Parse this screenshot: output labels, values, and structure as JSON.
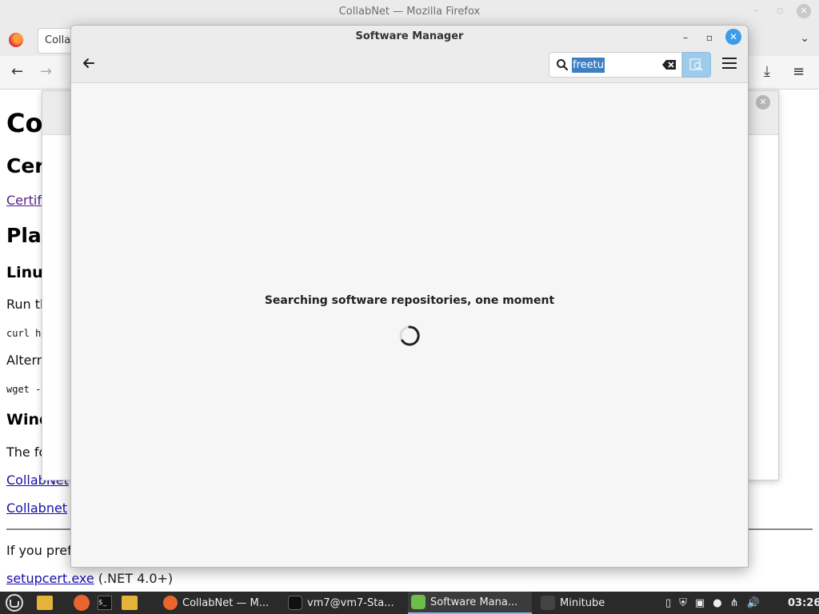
{
  "firefox": {
    "window_title": "CollabNet — Mozilla Firefox",
    "tab_label": "Collab",
    "content": {
      "h1": "Co",
      "h2_cert": "Cer",
      "link_cert": "Certif",
      "h2_plat": "Pla",
      "h3_linux": "Linu",
      "p_run": "Run th",
      "code_curl": "curl h",
      "p_alt": "Altern",
      "code_wget": "wget -",
      "h3_win": "Wind",
      "p_the": "The fo",
      "link_collab1": "CollabNet",
      "link_collab2": "Collabnet",
      "p_ifyou": "If you pref",
      "link_setup": "setupcert.exe",
      "p_net": " (.NET 4.0+)"
    }
  },
  "software_manager": {
    "title": "Software Manager",
    "search": {
      "value": "freetu",
      "placeholder": ""
    },
    "status": "Searching software repositories, one moment"
  },
  "taskbar": {
    "tasks": [
      {
        "label": "CollabNet — M...",
        "icon": "firefox-icon"
      },
      {
        "label": "vm7@vm7-Sta...",
        "icon": "terminal-icon"
      },
      {
        "label": "Software Mana...",
        "icon": "software-manager-icon"
      },
      {
        "label": "Minitube",
        "icon": "minitube-icon"
      }
    ],
    "clock": "03:26"
  },
  "colors": {
    "accent": "#3d9be9",
    "selection": "#3e7fc4",
    "taskbar": "#2a2a2a"
  }
}
